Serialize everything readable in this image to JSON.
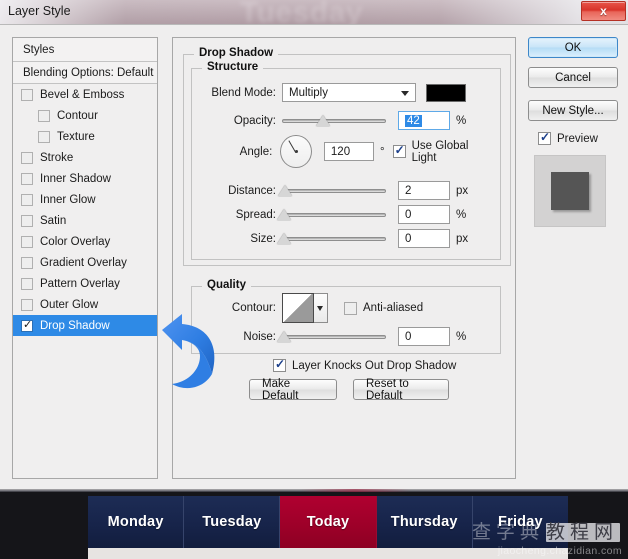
{
  "window": {
    "title": "Layer Style",
    "close_label": "x",
    "backdrop_word": "Tuesday"
  },
  "styles_panel": {
    "header": "Styles",
    "blending_options": "Blending Options: Default",
    "items": [
      {
        "label": "Bevel & Emboss",
        "checked": false,
        "indent": false,
        "selected": false
      },
      {
        "label": "Contour",
        "checked": false,
        "indent": true,
        "selected": false
      },
      {
        "label": "Texture",
        "checked": false,
        "indent": true,
        "selected": false
      },
      {
        "label": "Stroke",
        "checked": false,
        "indent": false,
        "selected": false
      },
      {
        "label": "Inner Shadow",
        "checked": false,
        "indent": false,
        "selected": false
      },
      {
        "label": "Inner Glow",
        "checked": false,
        "indent": false,
        "selected": false
      },
      {
        "label": "Satin",
        "checked": false,
        "indent": false,
        "selected": false
      },
      {
        "label": "Color Overlay",
        "checked": false,
        "indent": false,
        "selected": false
      },
      {
        "label": "Gradient Overlay",
        "checked": false,
        "indent": false,
        "selected": false
      },
      {
        "label": "Pattern Overlay",
        "checked": false,
        "indent": false,
        "selected": false
      },
      {
        "label": "Outer Glow",
        "checked": false,
        "indent": false,
        "selected": false
      },
      {
        "label": "Drop Shadow",
        "checked": true,
        "indent": false,
        "selected": true
      }
    ],
    "selected_color": "#2e8ae6"
  },
  "settings": {
    "group_title": "Drop Shadow",
    "structure": {
      "title": "Structure",
      "blend_mode_label": "Blend Mode:",
      "blend_mode_value": "Multiply",
      "blend_color": "#000000",
      "opacity_label": "Opacity:",
      "opacity_value": "42",
      "opacity_unit": "%",
      "angle_label": "Angle:",
      "angle_value": "120",
      "angle_unit": "°",
      "use_global_light": "Use Global Light",
      "use_global_light_checked": true,
      "distance_label": "Distance:",
      "distance_value": "2",
      "distance_unit": "px",
      "spread_label": "Spread:",
      "spread_value": "0",
      "spread_unit": "%",
      "size_label": "Size:",
      "size_value": "0",
      "size_unit": "px"
    },
    "quality": {
      "title": "Quality",
      "contour_label": "Contour:",
      "anti_aliased_label": "Anti-aliased",
      "anti_aliased_checked": false,
      "noise_label": "Noise:",
      "noise_value": "0",
      "noise_unit": "%"
    },
    "knocks_out_label": "Layer Knocks Out Drop Shadow",
    "knocks_out_checked": true,
    "make_default_label": "Make Default",
    "reset_default_label": "Reset to Default"
  },
  "buttons": {
    "ok": "OK",
    "cancel": "Cancel",
    "new_style": "New Style...",
    "preview": "Preview",
    "preview_checked": true
  },
  "bottom_nav": {
    "tabs": [
      {
        "label": "Monday",
        "active": false
      },
      {
        "label": "Tuesday",
        "active": false
      },
      {
        "label": "Today",
        "active": true
      },
      {
        "label": "Thursday",
        "active": false
      },
      {
        "label": "Friday",
        "active": false
      }
    ],
    "active_color": "#a30029",
    "inactive_color": "#17244a"
  },
  "watermark": {
    "cn_text": "查字典",
    "cn_boxed": "教程网",
    "url": "jiaocheng.chazidian.com"
  }
}
